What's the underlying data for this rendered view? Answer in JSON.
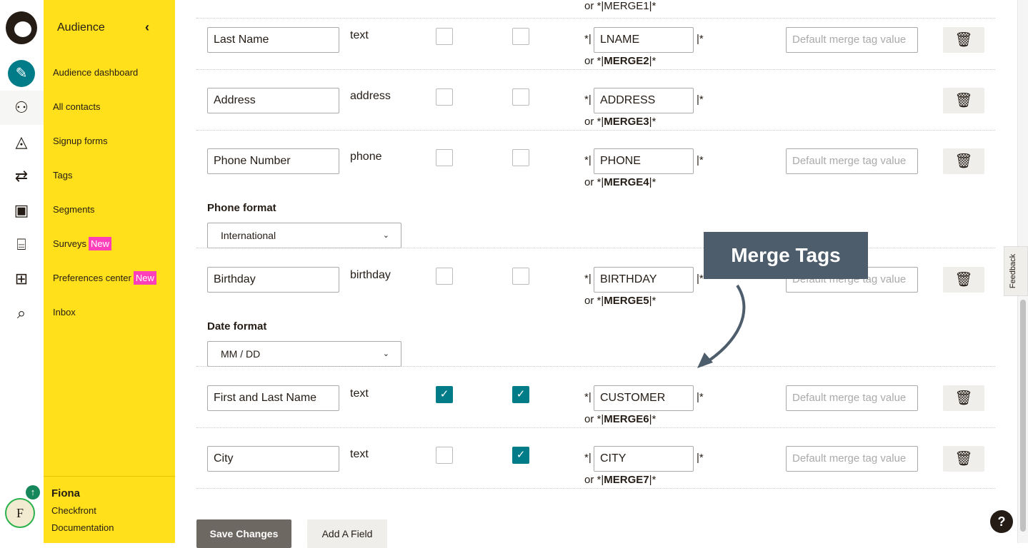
{
  "nav": {
    "title": "Audience",
    "items": [
      {
        "label": "Audience dashboard"
      },
      {
        "label": "All contacts"
      },
      {
        "label": "Signup forms"
      },
      {
        "label": "Tags"
      },
      {
        "label": "Segments"
      },
      {
        "label": "Surveys",
        "badge": "New"
      },
      {
        "label": "Preferences center",
        "badge": "New"
      },
      {
        "label": "Inbox"
      }
    ],
    "user": {
      "name": "Fiona",
      "org": "Checkfront",
      "link": "Documentation",
      "avatar_letter": "F"
    }
  },
  "rail_icons": [
    "pencil-icon",
    "audience-icon",
    "campaigns-icon",
    "automations-icon",
    "website-icon",
    "content-icon",
    "integrations-icon",
    "search-icon"
  ],
  "top_partial": "or *|MERGE1|*",
  "fields": [
    {
      "name": "Last Name",
      "type": "text",
      "required": false,
      "visible": false,
      "tag": "LNAME",
      "alt": "MERGE2",
      "has_default": true
    },
    {
      "name": "Address",
      "type": "address",
      "required": false,
      "visible": false,
      "tag": "ADDRESS",
      "alt": "MERGE3",
      "has_default": false
    },
    {
      "name": "Phone Number",
      "type": "phone",
      "required": false,
      "visible": false,
      "tag": "PHONE",
      "alt": "MERGE4",
      "has_default": true,
      "format_label": "Phone format",
      "format": "International"
    },
    {
      "name": "Birthday",
      "type": "birthday",
      "required": false,
      "visible": false,
      "tag": "BIRTHDAY",
      "alt": "MERGE5",
      "has_default": true,
      "format_label": "Date format",
      "format": "MM / DD"
    },
    {
      "name": "First and Last Name",
      "type": "text",
      "required": true,
      "visible": true,
      "tag": "CUSTOMER",
      "alt": "MERGE6",
      "has_default": true
    },
    {
      "name": "City",
      "type": "text",
      "required": false,
      "visible": true,
      "tag": "CITY",
      "alt": "MERGE7",
      "has_default": true
    }
  ],
  "default_placeholder": "Default merge tag value",
  "buttons": {
    "save": "Save Changes",
    "add": "Add A Field"
  },
  "callout": "Merge Tags",
  "feedback": "Feedback",
  "help": "?",
  "colors": {
    "accent": "#007c89",
    "nav": "#ffe01b",
    "badge": "#ff3fb9",
    "callout": "#4e5d6c"
  }
}
